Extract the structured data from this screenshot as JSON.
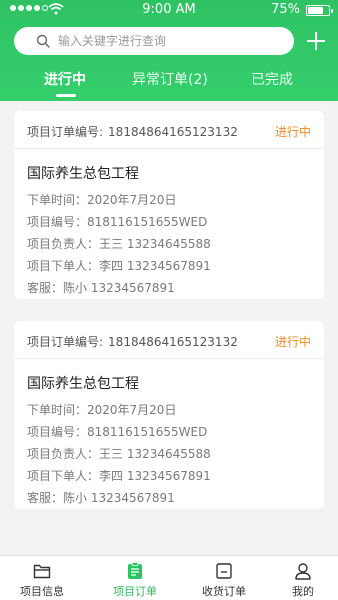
{
  "status_bar": {
    "time": "9:00 AM",
    "battery": "75%"
  },
  "search": {
    "placeholder": "输入关键字进行查询"
  },
  "tabs": [
    {
      "label": "进行中",
      "active": true
    },
    {
      "label": "异常订单(2)",
      "active": false
    },
    {
      "label": "已完成",
      "active": false
    }
  ],
  "orders": [
    {
      "order_label": "项目订单编号:",
      "order_no": "18184864165123132",
      "status": "进行中",
      "title": "国际养生总包工程",
      "order_time": "下单时间：2020年7月20日",
      "project_no": "项目编号：818116151655WED",
      "manager": "项目负责人：王三   13234645588",
      "orderer": "项目下单人：李四   13234567891",
      "service": "客服：陈小   13234567891"
    },
    {
      "order_label": "项目订单编号:",
      "order_no": "18184864165123132",
      "status": "进行中",
      "title": "国际养生总包工程",
      "order_time": "下单时间：2020年7月20日",
      "project_no": "项目编号：818116151655WED",
      "manager": "项目负责人：王三   13234645588",
      "orderer": "项目下单人：李四   13234567891",
      "service": "客服：陈小   13234567891"
    }
  ],
  "bottom_nav": [
    {
      "label": "项目信息",
      "icon": "folder-icon"
    },
    {
      "label": "项目订单",
      "icon": "clipboard-icon",
      "active": true
    },
    {
      "label": "收货订单",
      "icon": "box-icon"
    },
    {
      "label": "我的",
      "icon": "user-icon"
    }
  ],
  "colors": {
    "primary": "#2fc264",
    "status": "#f08c23"
  }
}
